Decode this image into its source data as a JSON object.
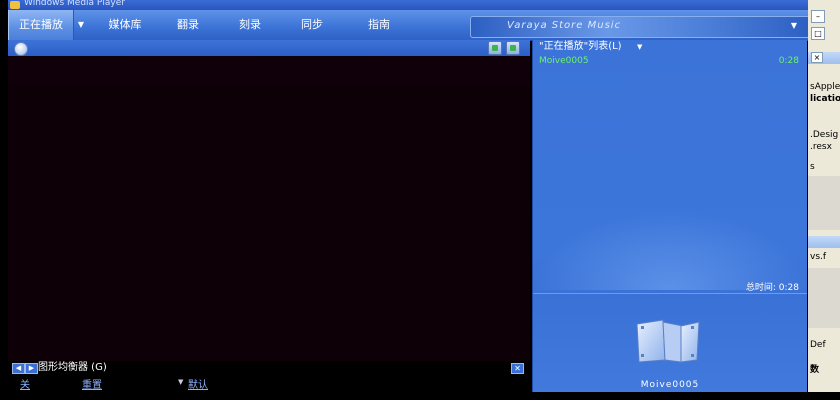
{
  "window": {
    "title": "Windows Media Player"
  },
  "tabs": [
    {
      "label": "正在播放",
      "active": true
    },
    {
      "label": "媒体库",
      "active": false
    },
    {
      "label": "翻录",
      "active": false
    },
    {
      "label": "刻录",
      "active": false
    },
    {
      "label": "同步",
      "active": false
    },
    {
      "label": "指南",
      "active": false
    }
  ],
  "store": {
    "label": "Varaya Store Music"
  },
  "equalizer": {
    "title": "图形均衡器 (G)",
    "option_off": "关",
    "option_reset": "重置",
    "preset": "默认"
  },
  "playlist": {
    "title": "\"正在播放\"列表(L)",
    "items": [
      {
        "name": "Moive0005",
        "duration": "0:28"
      }
    ],
    "total_time": "总时间: 0:28",
    "art_label": "Moive0005"
  },
  "ide": {
    "lines": [
      "sApple",
      "licatio",
      ".Desig",
      ".resx",
      "s",
      "vs.f",
      "Def",
      "数"
    ]
  },
  "colors": {
    "accent": "#3b73d8",
    "playlist_text": "#6ef06e"
  }
}
